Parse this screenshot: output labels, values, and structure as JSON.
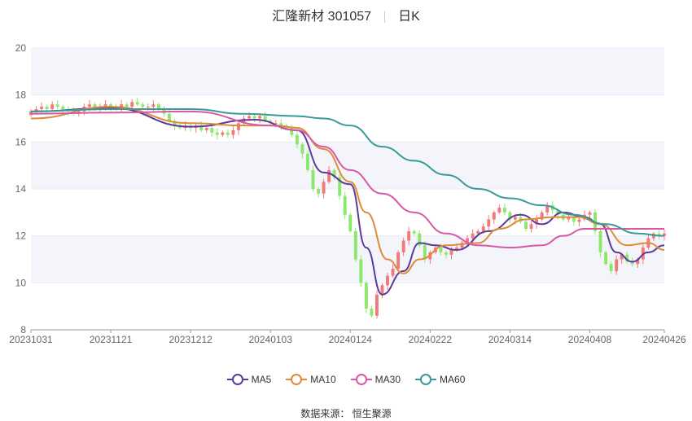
{
  "header": {
    "title": "汇隆新材 301057",
    "period": "日K"
  },
  "source": "数据来源： 恒生聚源",
  "colors": {
    "up": "#f07a7a",
    "down": "#8be86b",
    "grid": "#e8ecf3",
    "band": "#f3f5fa"
  },
  "legend": [
    {
      "name": "MA5",
      "color": "#5b3a9a"
    },
    {
      "name": "MA10",
      "color": "#e08a3a"
    },
    {
      "name": "MA30",
      "color": "#d957a8"
    },
    {
      "name": "MA60",
      "color": "#3a9a9a"
    }
  ],
  "chart_data": {
    "type": "candlestick",
    "ylim": [
      8,
      20
    ],
    "yticks": [
      8,
      10,
      12,
      14,
      16,
      18,
      20
    ],
    "xtick_labels": [
      "20231031",
      "20231121",
      "20231212",
      "20240103",
      "20240124",
      "20240222",
      "20240314",
      "20240408",
      "20240426"
    ],
    "xtick_index": [
      0,
      15,
      30,
      45,
      60,
      75,
      90,
      105,
      119
    ],
    "n_days": 120,
    "close": [
      17.3,
      17.4,
      17.5,
      17.4,
      17.6,
      17.5,
      17.4,
      17.3,
      17.2,
      17.3,
      17.5,
      17.6,
      17.4,
      17.5,
      17.6,
      17.5,
      17.4,
      17.6,
      17.5,
      17.7,
      17.6,
      17.5,
      17.5,
      17.6,
      17.4,
      17.2,
      16.9,
      16.7,
      16.6,
      16.7,
      16.6,
      16.7,
      16.5,
      16.6,
      16.4,
      16.3,
      16.4,
      16.3,
      16.5,
      16.8,
      17.0,
      17.1,
      17.0,
      17.1,
      16.9,
      16.8,
      16.8,
      16.7,
      16.6,
      16.3,
      15.9,
      15.5,
      14.8,
      14.0,
      13.8,
      14.3,
      14.8,
      14.5,
      13.7,
      12.9,
      12.2,
      11.0,
      10.0,
      8.9,
      8.6,
      9.5,
      9.9,
      10.3,
      10.6,
      11.3,
      11.8,
      12.2,
      12.1,
      11.6,
      11.0,
      11.3,
      11.5,
      11.3,
      11.2,
      11.4,
      11.5,
      11.7,
      11.9,
      12.1,
      12.2,
      12.4,
      12.7,
      13.0,
      13.2,
      13.0,
      12.7,
      12.8,
      12.6,
      12.3,
      12.5,
      12.7,
      13.0,
      13.3,
      13.1,
      12.9,
      12.7,
      12.8,
      12.6,
      12.7,
      12.9,
      13.0,
      12.2,
      11.3,
      10.8,
      10.5,
      11.0,
      11.2,
      10.9,
      10.8,
      11.0,
      11.5,
      11.9,
      12.1,
      12.0,
      12.1
    ],
    "ma": {
      "MA5": [
        [
          0,
          17.3
        ],
        [
          15,
          17.45
        ],
        [
          30,
          16.65
        ],
        [
          42,
          16.95
        ],
        [
          50,
          16.5
        ],
        [
          55,
          14.7
        ],
        [
          60,
          14.2
        ],
        [
          63,
          11.5
        ],
        [
          66,
          9.5
        ],
        [
          70,
          10.5
        ],
        [
          73,
          11.7
        ],
        [
          76,
          11.6
        ],
        [
          80,
          11.4
        ],
        [
          86,
          12.2
        ],
        [
          92,
          12.9
        ],
        [
          96,
          12.5
        ],
        [
          100,
          13.0
        ],
        [
          104,
          12.8
        ],
        [
          107,
          12.5
        ],
        [
          110,
          11.3
        ],
        [
          113,
          10.9
        ],
        [
          116,
          11.3
        ],
        [
          119,
          11.6
        ]
      ],
      "MA10": [
        [
          0,
          17.0
        ],
        [
          15,
          17.5
        ],
        [
          30,
          16.8
        ],
        [
          40,
          16.7
        ],
        [
          46,
          16.7
        ],
        [
          50,
          16.6
        ],
        [
          55,
          15.7
        ],
        [
          60,
          14.3
        ],
        [
          63,
          13.0
        ],
        [
          67,
          11.0
        ],
        [
          70,
          10.4
        ],
        [
          73,
          11.0
        ],
        [
          78,
          11.6
        ],
        [
          84,
          11.7
        ],
        [
          88,
          12.3
        ],
        [
          93,
          12.7
        ],
        [
          98,
          12.8
        ],
        [
          103,
          12.8
        ],
        [
          107,
          12.5
        ],
        [
          112,
          11.6
        ],
        [
          116,
          11.7
        ],
        [
          119,
          11.4
        ]
      ],
      "MA30": [
        [
          0,
          17.2
        ],
        [
          15,
          17.25
        ],
        [
          30,
          17.3
        ],
        [
          45,
          16.7
        ],
        [
          50,
          16.5
        ],
        [
          55,
          15.8
        ],
        [
          60,
          14.8
        ],
        [
          66,
          13.8
        ],
        [
          72,
          13.0
        ],
        [
          78,
          12.1
        ],
        [
          84,
          11.6
        ],
        [
          90,
          11.5
        ],
        [
          96,
          11.6
        ],
        [
          100,
          12.0
        ],
        [
          104,
          12.3
        ],
        [
          110,
          12.3
        ],
        [
          119,
          12.3
        ]
      ],
      "MA60": [
        [
          0,
          17.3
        ],
        [
          15,
          17.4
        ],
        [
          30,
          17.4
        ],
        [
          40,
          17.2
        ],
        [
          50,
          17.1
        ],
        [
          55,
          17.0
        ],
        [
          60,
          16.7
        ],
        [
          66,
          15.8
        ],
        [
          72,
          15.2
        ],
        [
          78,
          14.6
        ],
        [
          84,
          14.0
        ],
        [
          90,
          13.6
        ],
        [
          96,
          13.3
        ],
        [
          102,
          12.9
        ],
        [
          108,
          12.5
        ],
        [
          114,
          12.1
        ],
        [
          119,
          12.0
        ]
      ]
    }
  }
}
